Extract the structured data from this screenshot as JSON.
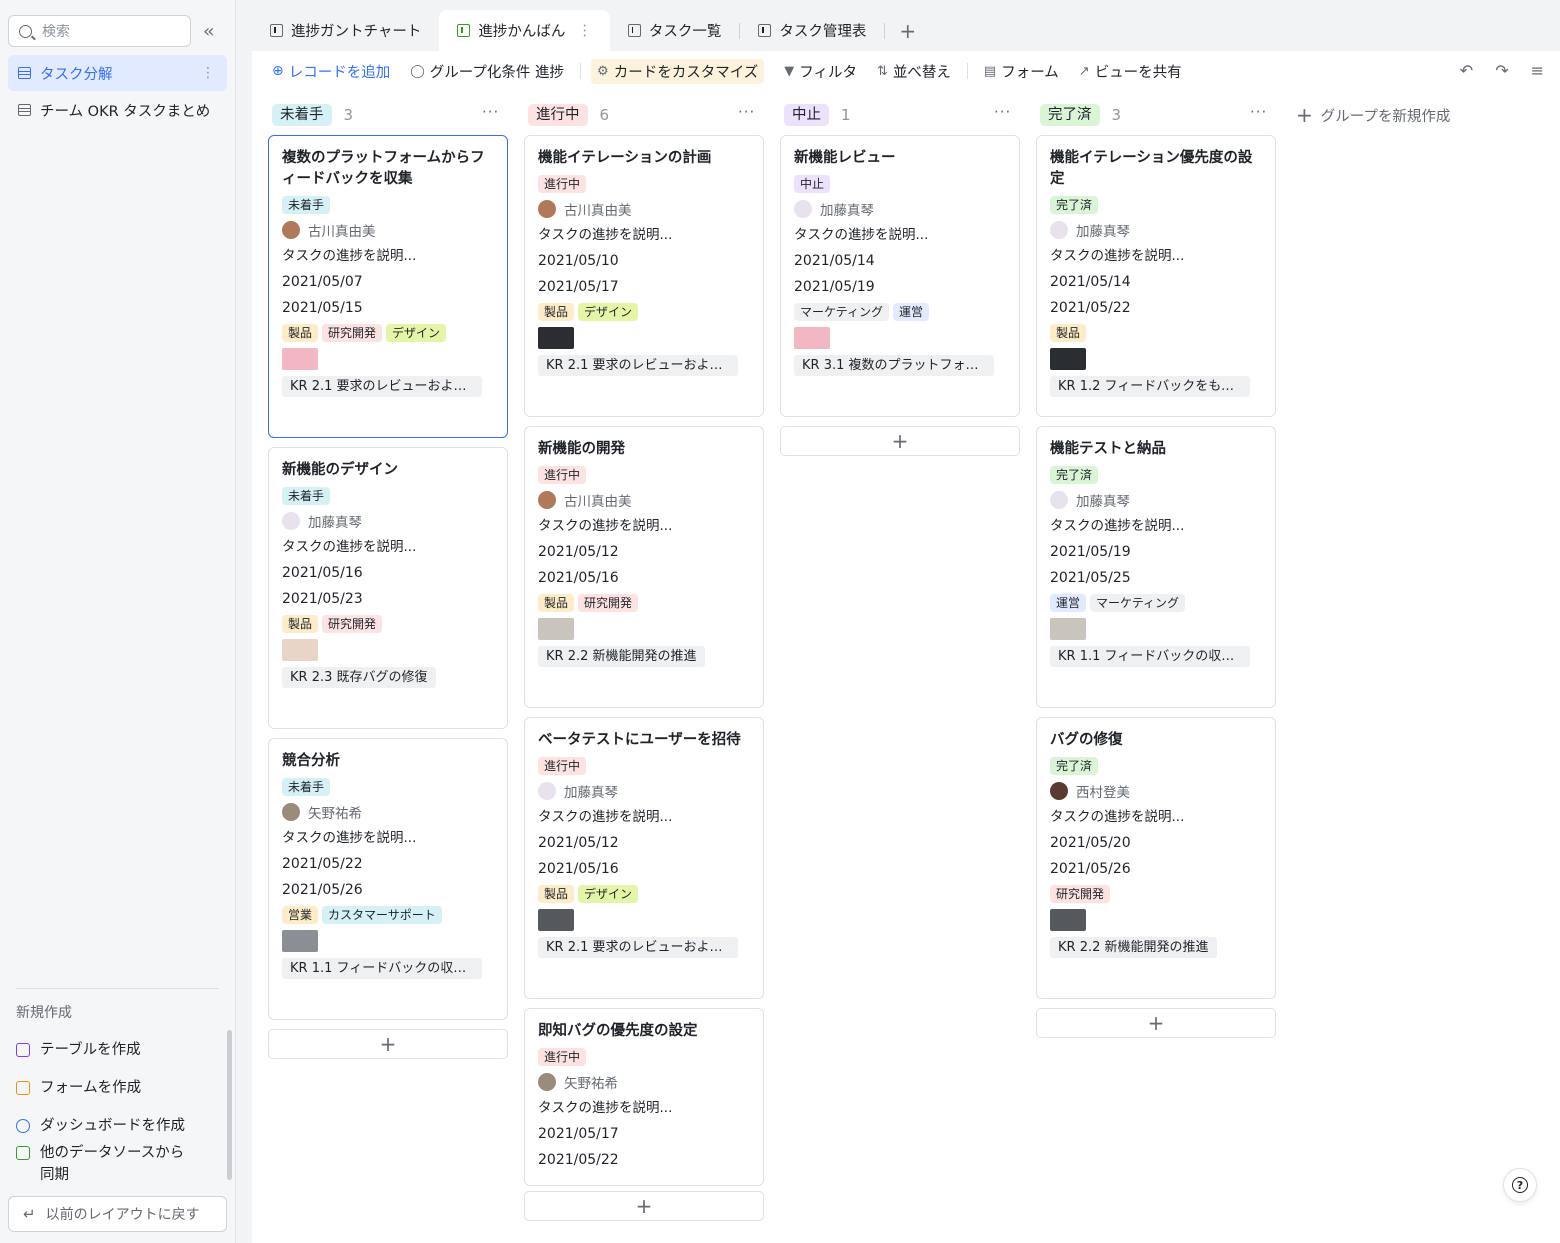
{
  "sidebar": {
    "search_placeholder": "検索",
    "items": [
      {
        "label": "タスク分解",
        "active": true
      },
      {
        "label": "チーム OKR タスクまとめ",
        "active": false
      }
    ],
    "section_label": "新規作成",
    "create": [
      {
        "label": "テーブルを作成",
        "icon": "table-icon",
        "color": "#7f3bf5"
      },
      {
        "label": "フォームを作成",
        "icon": "form-icon",
        "color": "#f58f15"
      },
      {
        "label": "ダッシュボードを作成",
        "icon": "dashboard-icon",
        "color": "#3370ff"
      },
      {
        "label": "他のデータソースから同期",
        "icon": "sync-icon",
        "color": "#2ea121"
      }
    ],
    "back_label": "以前のレイアウトに戻す"
  },
  "tabs": [
    {
      "label": "進捗ガントチャート",
      "active": false
    },
    {
      "label": "進捗かんばん",
      "active": true
    },
    {
      "label": "タスク一覧",
      "active": false
    },
    {
      "label": "タスク管理表",
      "active": false
    }
  ],
  "toolbar": {
    "add_record": "レコードを追加",
    "group_by": "グループ化条件 進捗",
    "customize_card": "カードをカスタマイズ",
    "filter": "フィルタ",
    "sort": "並べ替え",
    "form": "フォーム",
    "share_view": "ビューを共有"
  },
  "new_group_label": "グループを新規作成",
  "columns": [
    {
      "status": "未着手",
      "count": "3",
      "bg": "#d5f1f5",
      "color": "#1f2329",
      "cards": [
        {
          "title": "複数のプラットフォームからフィードバックを収集",
          "status": "未着手",
          "person": "古川真由美",
          "desc": "タスクの進捗を説明...",
          "start": "2021/05/07",
          "end": "2021/05/15",
          "tags": [
            "製品",
            "研究開発",
            "デザイン"
          ],
          "kr": "KR 2.1 要求のレビューおよびタ..."
        },
        {
          "title": "新機能のデザイン",
          "status": "未着手",
          "person": "加藤真琴",
          "desc": "タスクの進捗を説明...",
          "start": "2021/05/16",
          "end": "2021/05/23",
          "tags": [
            "製品",
            "研究開発"
          ],
          "kr": "KR 2.3 既存バグの修復"
        },
        {
          "title": "競合分析",
          "status": "未着手",
          "person": "矢野祐希",
          "desc": "タスクの進捗を説明...",
          "start": "2021/05/22",
          "end": "2021/05/26",
          "tags": [
            "営業",
            "カスタマーサポート"
          ],
          "kr": "KR 1.1 フィードバックの収集お..."
        }
      ]
    },
    {
      "status": "進行中",
      "count": "6",
      "bg": "#fde2e2",
      "color": "#1f2329",
      "cards": [
        {
          "title": "機能イテレーションの計画",
          "status": "進行中",
          "person": "古川真由美",
          "desc": "タスクの進捗を説明...",
          "start": "2021/05/10",
          "end": "2021/05/17",
          "tags": [
            "製品",
            "デザイン"
          ],
          "kr": "KR 2.1 要求のレビューおよびタ..."
        },
        {
          "title": "新機能の開発",
          "status": "進行中",
          "person": "古川真由美",
          "desc": "タスクの進捗を説明...",
          "start": "2021/05/12",
          "end": "2021/05/16",
          "tags": [
            "製品",
            "研究開発"
          ],
          "kr": "KR 2.2 新機能開発の推進"
        },
        {
          "title": "ベータテストにユーザーを招待",
          "status": "進行中",
          "person": "加藤真琴",
          "desc": "タスクの進捗を説明...",
          "start": "2021/05/12",
          "end": "2021/05/16",
          "tags": [
            "製品",
            "デザイン"
          ],
          "kr": "KR 2.1 要求のレビューおよびタ..."
        },
        {
          "title": "即知バグの優先度の設定",
          "status": "進行中",
          "person": "矢野祐希",
          "desc": "タスクの進捗を説明...",
          "start": "2021/05/17",
          "end": "2021/05/22",
          "tags": [],
          "kr": ""
        }
      ]
    },
    {
      "status": "中止",
      "count": "1",
      "bg": "#ece2fe",
      "color": "#1f2329",
      "cards": [
        {
          "title": "新機能レビュー",
          "status": "中止",
          "person": "加藤真琴",
          "desc": "タスクの進捗を説明...",
          "start": "2021/05/14",
          "end": "2021/05/19",
          "tags": [
            "マーケティング",
            "運営"
          ],
          "kr": "KR 3.1 複数のプラットフォーム..."
        }
      ]
    },
    {
      "status": "完了済",
      "count": "3",
      "bg": "#d9f5d6",
      "color": "#1f2329",
      "cards": [
        {
          "title": "機能イテレーション優先度の設定",
          "status": "完了済",
          "person": "加藤真琴",
          "desc": "タスクの進捗を説明...",
          "start": "2021/05/14",
          "end": "2021/05/22",
          "tags": [
            "製品"
          ],
          "kr": "KR 1.2 フィードバックをもとに..."
        },
        {
          "title": "機能テストと納品",
          "status": "完了済",
          "person": "加藤真琴",
          "desc": "タスクの進捗を説明...",
          "start": "2021/05/19",
          "end": "2021/05/25",
          "tags": [
            "運営",
            "マーケティング"
          ],
          "kr": "KR 1.1 フィードバックの収集お..."
        },
        {
          "title": "バグの修復",
          "status": "完了済",
          "person": "西村登美",
          "desc": "タスクの進捗を説明...",
          "start": "2021/05/20",
          "end": "2021/05/26",
          "tags": [
            "研究開発"
          ],
          "kr": "KR 2.2 新機能開発の推進"
        }
      ]
    }
  ],
  "tag_colors": {
    "未着手": "#d5f1f5",
    "進行中": "#fde2e2",
    "中止": "#ece2fe",
    "完了済": "#d9f5d6",
    "製品": "#fdecc8",
    "研究開発": "#fde2e2",
    "デザイン": "#e4f5a8",
    "営業": "#fdecc8",
    "カスタマーサポート": "#d5f1f5",
    "マーケティング": "#eff0f1",
    "運営": "#e1eaff"
  },
  "avatars": {
    "古川真由美": "#b07a5a",
    "加藤真琴": "#e8e2ef",
    "矢野祐希": "#9a8b7a",
    "西村登美": "#5a3b34"
  }
}
